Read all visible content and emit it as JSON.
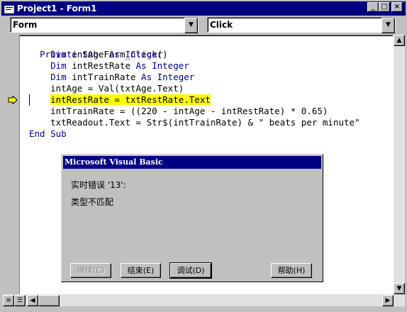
{
  "window": {
    "title": "Project1 - Form1"
  },
  "title_buttons": {
    "minimize": "_",
    "maximize": "□",
    "close": "×"
  },
  "object_combo": {
    "value": "Form"
  },
  "procedure_combo": {
    "value": "Click"
  },
  "code_lines": [
    "Private Sub Form_Click()",
    "    Dim intAge As Integer",
    "    Dim intRestRate As Integer",
    "    Dim intTrainRate As Integer",
    "    intAge = Val(txtAge.Text)",
    "    intRestRate = txtRestRate.Text",
    "    intTrainRate = ((220 - intAge - intRestRate) * 0.65)",
    "    txtReadout.Text = Str$(intTrainRate) & \" beats per minute\"",
    "End Sub"
  ],
  "highlighted_line": "intRestRate = txtRestRate.Text",
  "execution_pointer_icon": "arrow-icon",
  "dialog": {
    "title": "Microsoft Visual Basic",
    "error_line": "实时错误 '13':",
    "message": "类型不匹配",
    "buttons": {
      "continue": "继续(C)",
      "end": "结束(E)",
      "debug": "调试(D)",
      "help": "帮助(H)"
    }
  },
  "colors": {
    "title_bar": "#000080",
    "highlight": "#ffff00",
    "keyword": "#00008b",
    "background": "#c0c0c0"
  }
}
